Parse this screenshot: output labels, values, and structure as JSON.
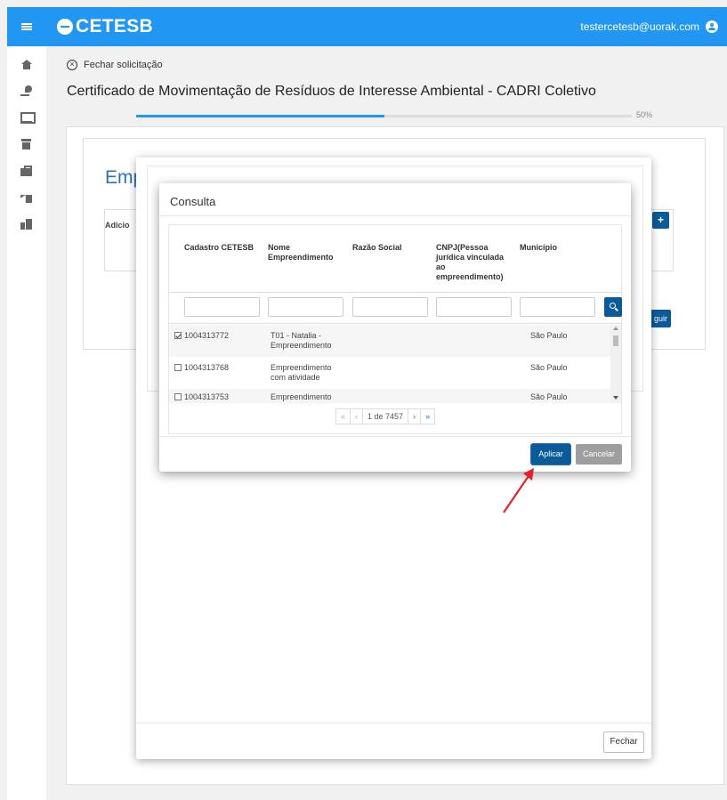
{
  "header": {
    "logo": "CETESB",
    "user_email": "testercetesb@uorak.com"
  },
  "sidebar": {
    "icons": [
      "home-icon",
      "plant-icon",
      "screen-icon",
      "archive-icon",
      "briefcase-icon",
      "factory-icon",
      "city-icon"
    ]
  },
  "page": {
    "close_label": "Fechar solicitação",
    "title": "Certificado de Movimentação de Resíduos de Interesse Ambiental - CADRI Coletivo",
    "progress_label": "50%",
    "progress_value": 0.5,
    "section_title": "Emp",
    "table_header_partial": "Adicio",
    "next_button_partial": "guir",
    "add_button": "+"
  },
  "outer_modal": {
    "close_button": "Fechar"
  },
  "consulta": {
    "title": "Consulta",
    "columns": [
      "Cadastro CETESB",
      "Nome Empreendimento",
      "Razão Social",
      "CNPJ(Pessoa jurídica vinculada ao empreendimento)",
      "Município"
    ],
    "rows": [
      {
        "cadastro": "1004313772",
        "nome": "T01 - Natalia - Empreendimento",
        "razao": "",
        "cnpj": "",
        "municipio": "São Paulo",
        "checked": true
      },
      {
        "cadastro": "1004313768",
        "nome": "Empreendimento com atividade",
        "razao": "",
        "cnpj": "",
        "municipio": "São Paulo",
        "checked": false
      },
      {
        "cadastro": "1004313753",
        "nome": "Empreendimento",
        "razao": "",
        "cnpj": "",
        "municipio": "São Paulo",
        "checked": false
      }
    ],
    "pager": {
      "first": "«",
      "prev": "‹",
      "page_info": "1 de 7457",
      "next": "›",
      "last": "»"
    },
    "apply_button": "Aplicar",
    "cancel_button": "Cancelar"
  },
  "colors": {
    "topbar": "#2196f3",
    "primary_button": "#0b5b9a",
    "arrow": "#e3222a"
  }
}
